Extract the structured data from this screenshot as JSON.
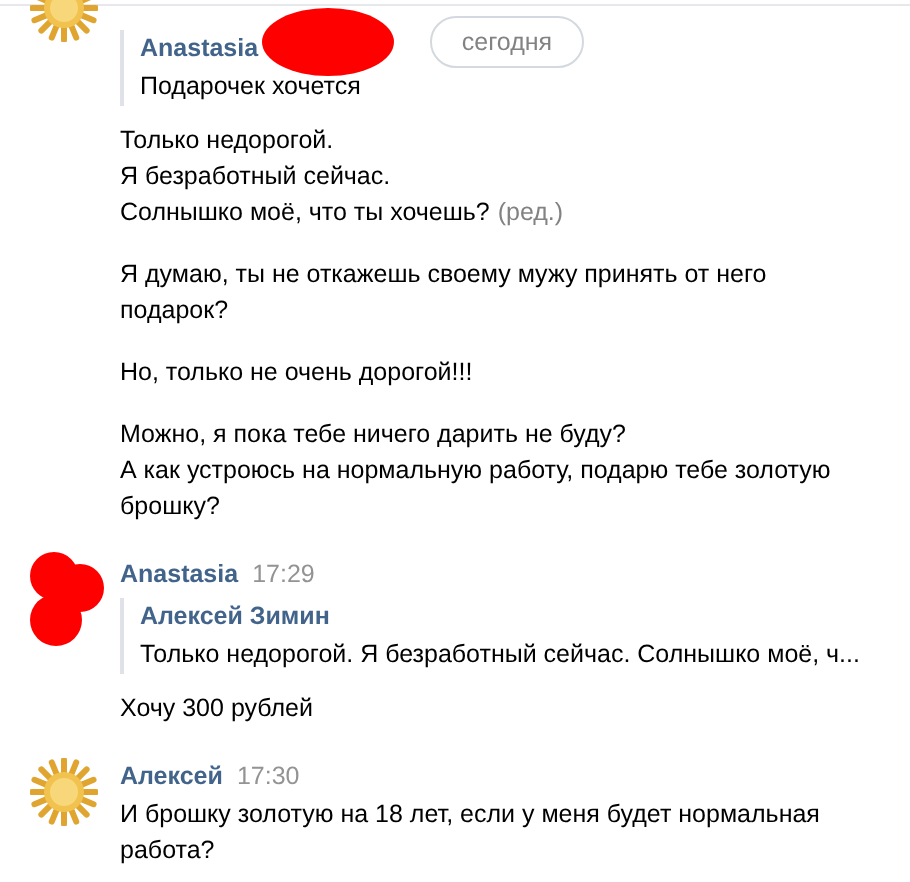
{
  "date_pill": "сегодня",
  "messages": [
    {
      "avatar": {
        "kind": "sun"
      },
      "quote": {
        "name": "Anastasia",
        "redacted": true,
        "text": "Подарочек хочется"
      },
      "paragraphs": [
        {
          "lines": [
            "Только недорогой.",
            "Я безработный сейчас.",
            "Солнышко моё, что ты хочешь?"
          ],
          "edited": "(ред.)"
        },
        {
          "lines": [
            "Я думаю, ты не откажешь своему мужу принять от него подарок?"
          ]
        },
        {
          "lines": [
            "Но, только не очень дорогой!!!"
          ]
        },
        {
          "lines": [
            "Можно, я пока тебе ничего дарить не буду?",
            "А как устроюсь на нормальную работу, подарю тебе золотую брошку?"
          ]
        }
      ]
    },
    {
      "avatar": {
        "kind": "redacted"
      },
      "author": "Anastasia",
      "time": "17:29",
      "quote": {
        "name": "Алексей Зимин",
        "text": "Только недорогой. Я безработный сейчас. Солнышко моё, ч..."
      },
      "paragraphs": [
        {
          "lines": [
            "Хочу 300 рублей"
          ]
        }
      ]
    },
    {
      "avatar": {
        "kind": "sun"
      },
      "author": "Алексей",
      "time": "17:30",
      "paragraphs": [
        {
          "lines": [
            "И брошку золотую на 18 лет, если у меня будет нормальная работа?"
          ]
        }
      ]
    }
  ]
}
